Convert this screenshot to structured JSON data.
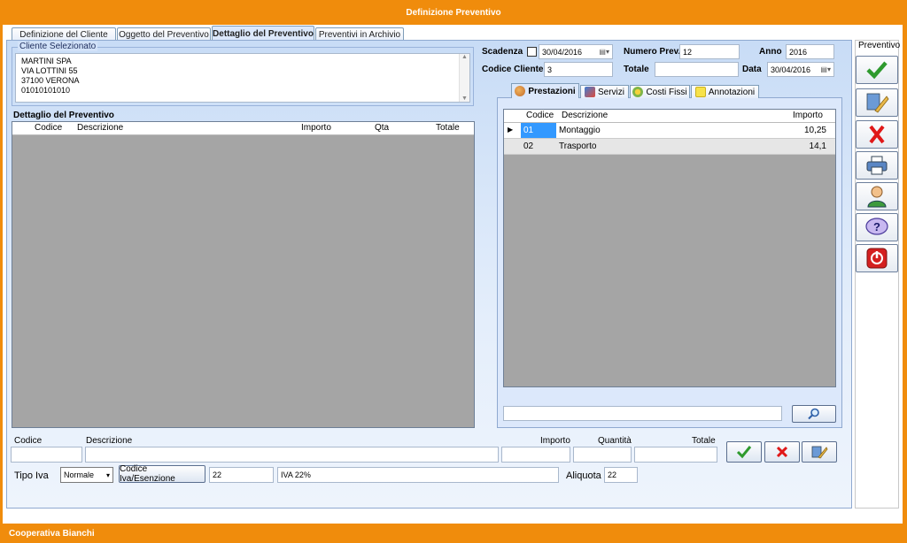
{
  "window": {
    "title": "Definizione Preventivo",
    "footer": "Cooperativa Bianchi"
  },
  "tabs": [
    {
      "label": "Definizione del Cliente"
    },
    {
      "label": "Oggetto del Preventivo"
    },
    {
      "label": "Dettaglio del Preventivo"
    },
    {
      "label": "Preventivi in Archivio"
    }
  ],
  "cliente": {
    "legend": "Cliente Selezionato",
    "lines": [
      "MARTINI SPA",
      "VIA LOTTINI 55",
      "37100 VERONA",
      "01010101010"
    ]
  },
  "dettaglio": {
    "title": "Dettaglio del Preventivo",
    "columns": {
      "codice": "Codice",
      "descrizione": "Descrizione",
      "importo": "Importo",
      "qta": "Qta",
      "totale": "Totale"
    }
  },
  "header_fields": {
    "scadenza_label": "Scadenza",
    "scadenza_value": "30/04/2016",
    "numero_label": "Numero Prev.",
    "numero_value": "12",
    "anno_label": "Anno",
    "anno_value": "2016",
    "codice_cliente_label": "Codice Cliente",
    "codice_cliente_value": "3",
    "totale_label": "Totale",
    "totale_value": "",
    "data_label": "Data",
    "data_value": "30/04/2016"
  },
  "subtabs": [
    {
      "label": "Prestazioni",
      "icon": "users-icon"
    },
    {
      "label": "Servizi",
      "icon": "tools-icon"
    },
    {
      "label": "Costi Fissi",
      "icon": "flower-icon"
    },
    {
      "label": "Annotazioni",
      "icon": "note-icon"
    }
  ],
  "prestazioni": {
    "columns": {
      "codice": "Codice",
      "descrizione": "Descrizione",
      "importo": "Importo"
    },
    "rows": [
      {
        "codice": "01",
        "descrizione": "Montaggio",
        "importo": "10,25"
      },
      {
        "codice": "02",
        "descrizione": "Trasporto",
        "importo": "14,1"
      }
    ],
    "search_value": ""
  },
  "entry": {
    "codice_label": "Codice",
    "descrizione_label": "Descrizione",
    "importo_label": "Importo",
    "quantita_label": "Quantità",
    "totale_label": "Totale",
    "tipo_iva_label": "Tipo Iva",
    "tipo_iva_value": "Normale",
    "codice_iva_button": "Codice Iva/Esenzione",
    "codice_iva_value": "22",
    "iva_descr_value": "IVA 22%",
    "aliquota_label": "Aliquota",
    "aliquota_value": "22"
  },
  "toolbar": {
    "title": "Preventivo"
  },
  "colors": {
    "accent": "#f08c0c",
    "panel": "#d2e2f8",
    "selected_row": "#3399ff"
  }
}
